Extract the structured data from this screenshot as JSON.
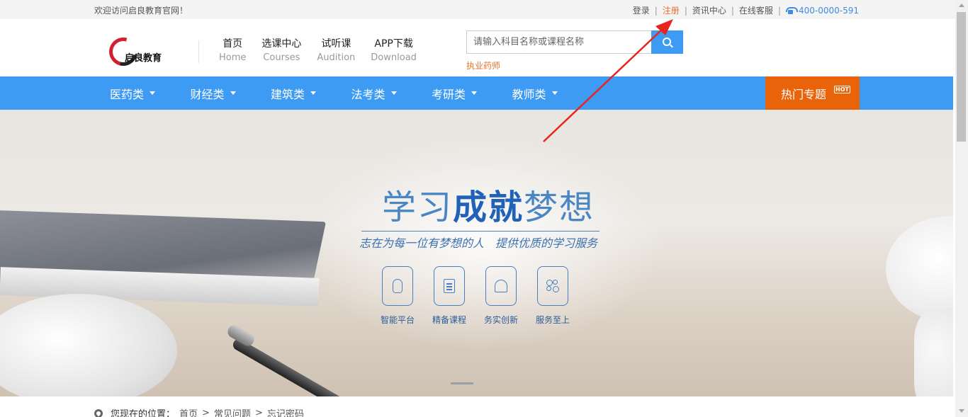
{
  "topbar": {
    "welcome": "欢迎访问启良教育官网！",
    "links": {
      "login": "登录",
      "register": "注册",
      "news": "资讯中心",
      "service": "在线客服",
      "phone": "400-0000-591"
    },
    "separator": "|"
  },
  "header": {
    "logo_text": "启良教育",
    "nav": [
      {
        "cn": "首页",
        "en": "Home"
      },
      {
        "cn": "选课中心",
        "en": "Courses"
      },
      {
        "cn": "试听课",
        "en": "Audition"
      },
      {
        "cn": "APP下载",
        "en": "Download"
      }
    ],
    "search": {
      "placeholder": "请输入科目名称或课程名称",
      "hot_keyword": "执业药师"
    }
  },
  "catnav": {
    "categories": [
      "医药类",
      "财经类",
      "建筑类",
      "法考类",
      "考研类",
      "教师类"
    ],
    "hot_special": "热门专题",
    "hot_badge": "HOT"
  },
  "banner": {
    "slogan_a": "学习",
    "slogan_b": "成就",
    "slogan_c": "梦想",
    "sub1": "志在为每一位有梦想的人",
    "sub2": "提供优质的学习服务",
    "features": [
      "智能平台",
      "精备课程",
      "务实创新",
      "服务至上"
    ]
  },
  "breadcrumb": {
    "label": "您现在的位置：",
    "items": [
      "首页",
      "常见问题",
      "忘记密码"
    ],
    "separator": ">"
  },
  "colors": {
    "accent_blue": "#3e9bf3",
    "hot_orange": "#e8630a",
    "link_orange": "#e8742a",
    "annotation_red": "#e8241f"
  }
}
